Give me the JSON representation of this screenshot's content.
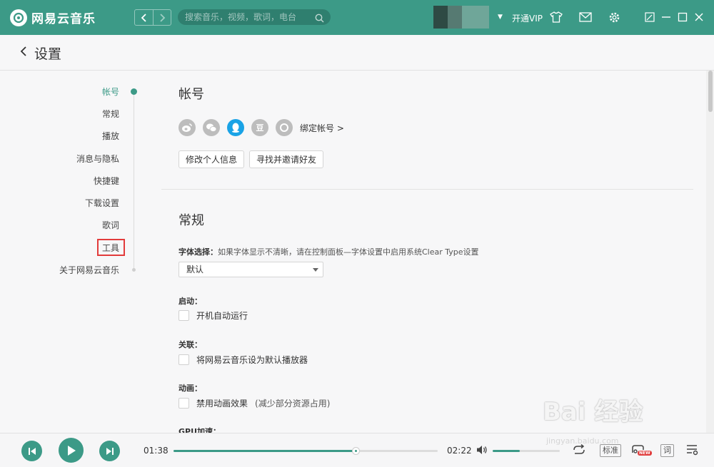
{
  "topbar": {
    "app_name": "网易云音乐",
    "search_placeholder": "搜索音乐，视频，歌词，电台",
    "vip_label": "开通VIP"
  },
  "header": {
    "title": "设置"
  },
  "sidebar": {
    "items": [
      {
        "label": "帐号",
        "active": true
      },
      {
        "label": "常规"
      },
      {
        "label": "播放"
      },
      {
        "label": "消息与隐私"
      },
      {
        "label": "快捷键"
      },
      {
        "label": "下载设置"
      },
      {
        "label": "歌词"
      },
      {
        "label": "工具",
        "highlighted": true
      },
      {
        "label": "关于网易云音乐"
      }
    ]
  },
  "account": {
    "title": "帐号",
    "social_icons": [
      "weibo-icon",
      "wechat-icon",
      "qq-icon",
      "douban-icon",
      "yixin-icon"
    ],
    "douban_glyph": "豆",
    "bind_label": "绑定帐号 >",
    "edit_profile": "修改个人信息",
    "invite_friends": "寻找并邀请好友"
  },
  "general": {
    "title": "常规",
    "font_label": "字体选择：",
    "font_hint": "如果字体显示不清晰，请在控制面板—字体设置中启用系统Clear Type设置",
    "font_value": "默认",
    "startup_label": "启动：",
    "startup_option": "开机自动运行",
    "assoc_label": "关联：",
    "assoc_option": "将网易云音乐设为默认播放器",
    "anim_label": "动画：",
    "anim_option": "禁用动画效果",
    "anim_note": "(减少部分资源占用)",
    "gpu_label": "GPU加速："
  },
  "player": {
    "elapsed": "01:38",
    "duration": "02:22",
    "progress": 0.69,
    "volume": 0.4,
    "quality_label": "标准",
    "new_badge": "NEW",
    "lyrics_label": "词"
  },
  "watermark": {
    "text": "Bai 经验",
    "url": "jingyan.baidu.com"
  },
  "colors": {
    "accent": "#3c9a87",
    "highlight_box": "#e23b3b"
  }
}
